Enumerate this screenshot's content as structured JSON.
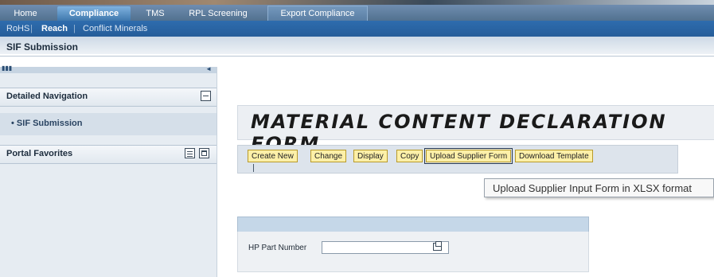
{
  "tabs": [
    "Home",
    "Compliance",
    "TMS",
    "RPL Screening",
    "Export Compliance"
  ],
  "subnav": {
    "items": [
      "RoHS",
      "Reach",
      "Conflict Minerals"
    ],
    "separator": "|"
  },
  "page_title": "SIF Submission",
  "left_panel": {
    "collapse_glyph": "◄",
    "detailed_navigation": {
      "title": "Detailed Navigation",
      "items": [
        "SIF Submission"
      ],
      "bullet": "•"
    },
    "portal_favorites": {
      "title": "Portal Favorites"
    }
  },
  "form": {
    "title": "MATERIAL CONTENT DECLARATION FORM",
    "buttons": [
      "Create New",
      "Change",
      "Display",
      "Copy",
      "Upload Supplier Form",
      "Download Template"
    ],
    "tooltip": "Upload Supplier Input Form in XLSX format",
    "fields": {
      "hp_part_number": {
        "label": "HP Part Number",
        "value": ""
      }
    }
  },
  "icons": {
    "minimize": "minus-box-icon",
    "favorites_menu": "menu-icon",
    "maximize": "window-icon",
    "value_help": "value-help-icon"
  },
  "colors": {
    "tab_bar": "#5f7fa2",
    "subnav": "#2a64a3",
    "button_fill": "#fdf0a8",
    "left_panel": "#e6ecf2"
  }
}
